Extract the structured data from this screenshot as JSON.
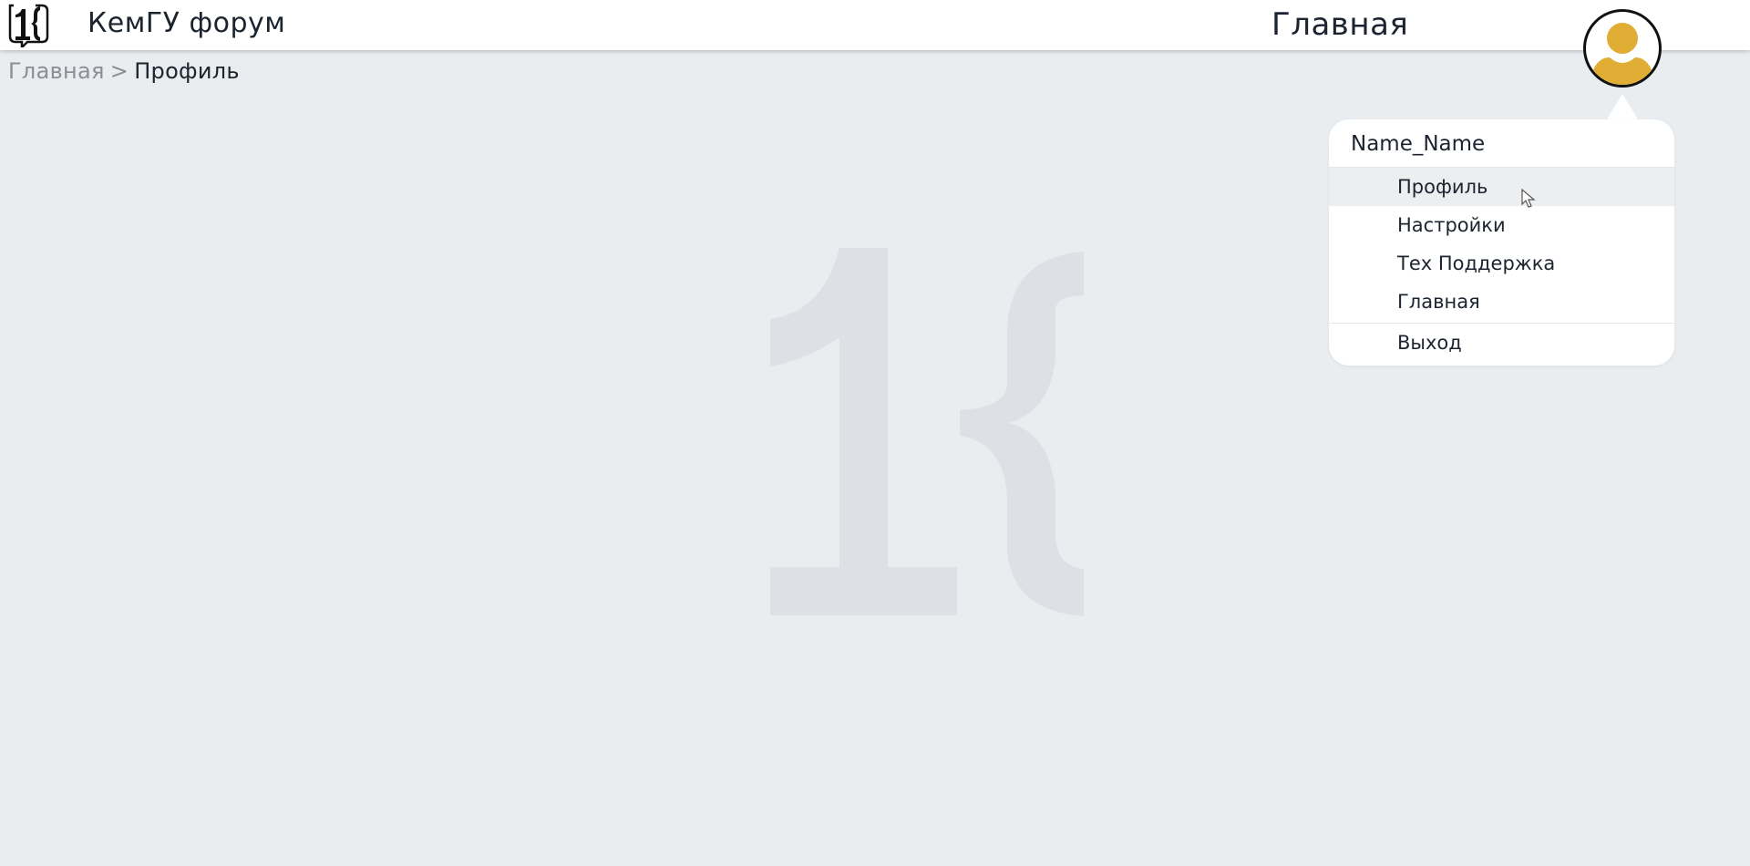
{
  "header": {
    "site_title": "КемГУ форум",
    "page_title": "Главная"
  },
  "breadcrumb": {
    "home": "Главная",
    "separator": ">",
    "current": "Профиль"
  },
  "user_menu": {
    "username": "Name_Name",
    "items": [
      {
        "label": "Профиль"
      },
      {
        "label": "Настройки"
      },
      {
        "label": "Тех Поддержка"
      },
      {
        "label": "Главная"
      },
      {
        "label": "Выход"
      }
    ]
  },
  "icons": {
    "logo": "1k-logo-icon",
    "avatar": "user-avatar-icon",
    "cursor": "mouse-pointer-icon"
  },
  "colors": {
    "background": "#e9edf0",
    "header_bg": "#ffffff",
    "avatar_accent": "#e0ad35",
    "text_dark": "#1c2430",
    "text_muted": "#8a8f95",
    "watermark": "#dde1e6"
  }
}
